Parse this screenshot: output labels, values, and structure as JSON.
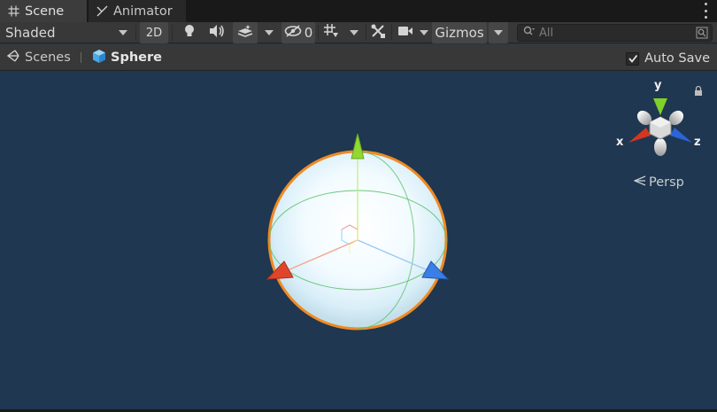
{
  "tabs": [
    {
      "label": "Scene",
      "icon": "grid-icon",
      "active": true
    },
    {
      "label": "Animator",
      "icon": "animator-icon",
      "active": false
    }
  ],
  "toolbar": {
    "draw_mode": "Shaded",
    "mode_2d": "2D",
    "hidden_count": "0",
    "gizmos": "Gizmos",
    "search_placeholder": "All"
  },
  "breadcrumb": {
    "scenes": "Scenes",
    "current": "Sphere"
  },
  "autosave": {
    "label": "Auto Save",
    "checked": true
  },
  "gizmo": {
    "x": "x",
    "y": "y",
    "z": "z",
    "projection": "Persp"
  },
  "colors": {
    "viewport_bg": "#1f3750",
    "selection_outline": "#f08a24",
    "x_axis": "#e0452b",
    "y_axis": "#7fd02a",
    "z_axis": "#3a7ee8"
  }
}
